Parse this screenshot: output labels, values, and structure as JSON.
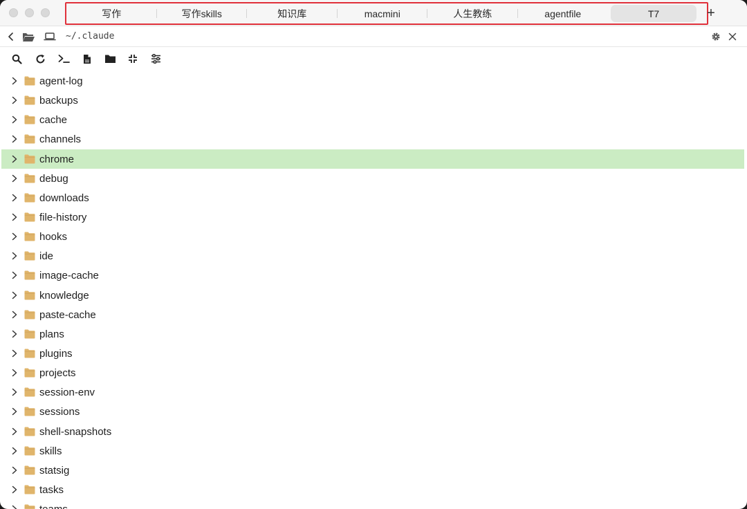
{
  "tabs": [
    "写作",
    "写作skills",
    "知识库",
    "macmini",
    "人生教练",
    "agentfile",
    "T7"
  ],
  "active_tab": "T7",
  "add_tab_label": "+",
  "path": "~/.claude",
  "files": [
    "agent-log",
    "backups",
    "cache",
    "channels",
    "chrome",
    "debug",
    "downloads",
    "file-history",
    "hooks",
    "ide",
    "image-cache",
    "knowledge",
    "paste-cache",
    "plans",
    "plugins",
    "projects",
    "session-env",
    "sessions",
    "shell-snapshots",
    "skills",
    "statsig",
    "tasks",
    "teams"
  ],
  "selected_file": "chrome",
  "colors": {
    "selection": "#cbecc3",
    "folder": "#e0b56b",
    "tab_highlight_border": "#e0303a"
  },
  "icons": {
    "pathbar": [
      "chevron-left-icon",
      "folder-open-icon",
      "laptop-icon",
      "gear-icon",
      "close-icon"
    ],
    "toolbar": [
      "search-icon",
      "refresh-icon",
      "terminal-icon",
      "new-file-icon",
      "new-folder-icon",
      "collapse-icon",
      "settings-sliders-icon"
    ]
  }
}
